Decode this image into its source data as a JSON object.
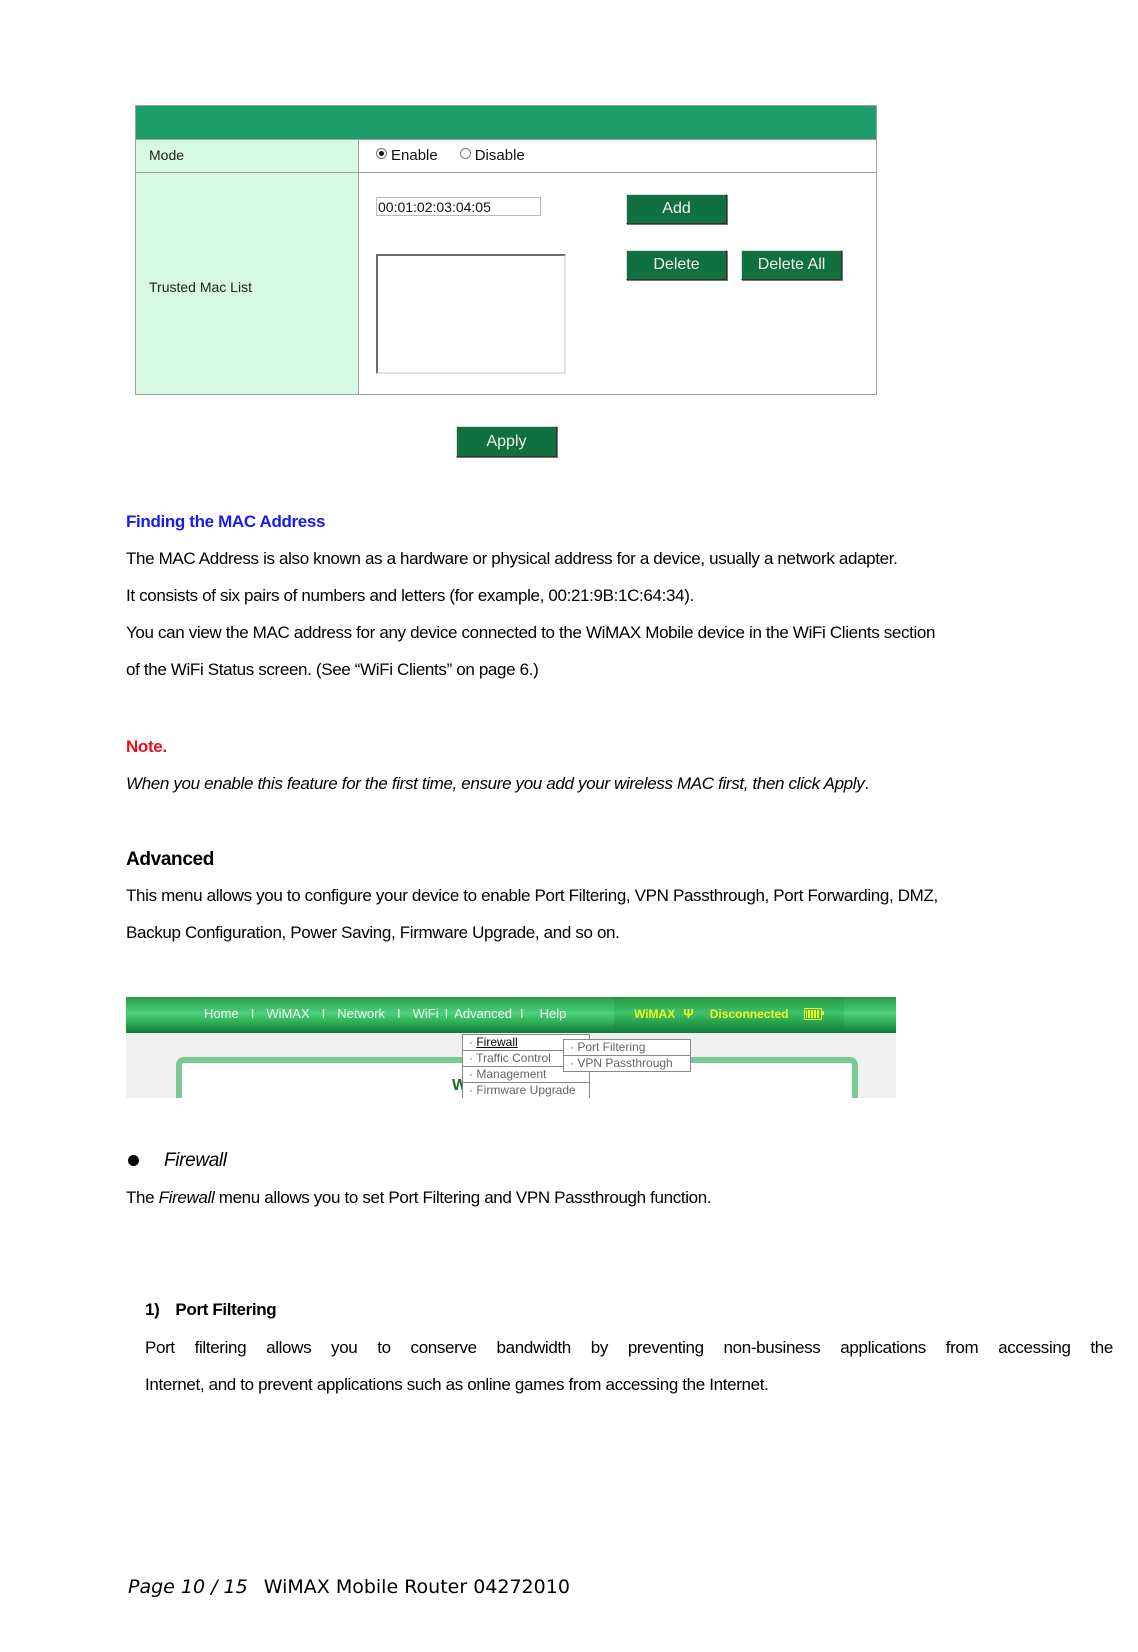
{
  "mac_filter_ui": {
    "mode_label": "Mode",
    "mode_options": [
      {
        "label": "Enable",
        "checked": true
      },
      {
        "label": "Disable",
        "checked": false
      }
    ],
    "trusted_label": "Trusted Mac List",
    "mac_input_value": "00:01:02:03:04:05",
    "buttons": {
      "add": "Add",
      "delete": "Delete",
      "delete_all": "Delete All",
      "apply": "Apply"
    },
    "colors": {
      "header": "#1f9c6b",
      "label_bg": "#d7f8e4",
      "button": "#117040"
    }
  },
  "finding_mac": {
    "heading": "Finding the MAC Address",
    "lines": [
      "The MAC Address is also known as a hardware or physical address for a device, usually a network adapter.",
      "It consists of six pairs of numbers and letters (for example, 00:21:9B:1C:64:34).",
      "You can view the MAC address for any device connected to the WiMAX Mobile device in the WiFi Clients section",
      "of the WiFi Status screen. (See “WiFi Clients” on page 6.)"
    ]
  },
  "note": {
    "heading": "Note.",
    "text_before": "When you enable this feature for the first time, ensure you add your wireless MAC first, then click ",
    "text_apply": "Apply",
    "text_after": "."
  },
  "advanced": {
    "heading": "Advanced",
    "lines": [
      "This menu allows you to configure your device to enable Port Filtering, VPN Passthrough, Port Forwarding, DMZ,",
      "Backup Configuration, Power Saving, Firmware Upgrade, and so on."
    ]
  },
  "nav_ui": {
    "links": [
      "Home",
      "WiMAX",
      "Network",
      "WiFi",
      "Advanced",
      "Help"
    ],
    "separator": "I",
    "status_network": "WiMAX",
    "status_connection": "Disconnected",
    "antenna_icon": "Ψ",
    "advanced_menu": [
      "Firewall",
      "Traffic Control",
      "Management",
      "Firmware Upgrade"
    ],
    "firewall_submenu": [
      "Port Filtering",
      "VPN Passthrough"
    ],
    "frame_title_fragment": "Wi",
    "menu_bullet": "·",
    "colors": {
      "status_text": "#f2f21e",
      "nav_green": "#2fae55"
    }
  },
  "firewall": {
    "bullet_title": "Firewall",
    "desc_prefix": "The ",
    "desc_italic": "Firewall",
    "desc_suffix": " menu allows you to set Port Filtering and VPN Passthrough function."
  },
  "port_filtering": {
    "number": "1)",
    "heading": "Port Filtering",
    "lines": [
      "Port filtering allows you to conserve bandwidth by preventing non-business applications from accessing the",
      "Internet, and to prevent applications such as online games from accessing the Internet."
    ]
  },
  "footer": {
    "page": "Page 10 / 15",
    "title": "WiMAX Mobile Router 04272010"
  }
}
